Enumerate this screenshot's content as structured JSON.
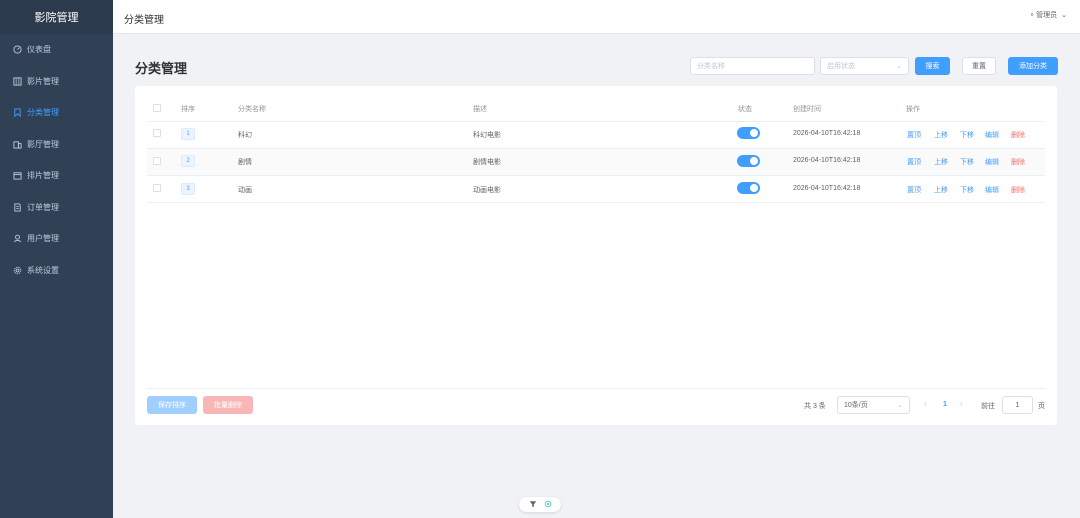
{
  "app": {
    "logo": "影院管理",
    "header_title": "分类管理",
    "user": "管理员"
  },
  "sidebar": {
    "items": [
      {
        "label": "仪表盘",
        "icon": "dashboard-icon"
      },
      {
        "label": "影片管理",
        "icon": "film-icon"
      },
      {
        "label": "分类管理",
        "icon": "bookmark-icon",
        "active": true
      },
      {
        "label": "影厅管理",
        "icon": "building-icon"
      },
      {
        "label": "排片管理",
        "icon": "calendar-icon"
      },
      {
        "label": "订单管理",
        "icon": "document-icon"
      },
      {
        "label": "用户管理",
        "icon": "user-icon"
      },
      {
        "label": "系统设置",
        "icon": "gear-icon"
      }
    ]
  },
  "page": {
    "title": "分类管理"
  },
  "filters": {
    "name_placeholder": "分类名称",
    "status_placeholder": "启用状态",
    "search_label": "搜索",
    "reset_label": "重置",
    "add_label": "添加分类"
  },
  "table": {
    "headers": {
      "order": "排序",
      "name": "分类名称",
      "desc": "描述",
      "status": "状态",
      "created": "创建时间",
      "actions": "操作"
    },
    "rows": [
      {
        "order": "1",
        "name": "科幻",
        "desc": "科幻电影",
        "enabled": true,
        "created": "2026-04-10T16:42:18"
      },
      {
        "order": "2",
        "name": "剧情",
        "desc": "剧情电影",
        "enabled": true,
        "created": "2026-04-10T16:42:18"
      },
      {
        "order": "3",
        "name": "动画",
        "desc": "动画电影",
        "enabled": true,
        "created": "2026-04-10T16:42:18"
      }
    ],
    "actions": {
      "top": "置顶",
      "up": "上移",
      "down": "下移",
      "edit": "编辑",
      "delete": "删除"
    }
  },
  "footer": {
    "save_order": "保存排序",
    "batch_delete": "批量删除",
    "total": "共 3 条",
    "page_size": "10条/页",
    "current_page": "1",
    "goto_label": "前往",
    "goto_value": "1",
    "page_unit": "页"
  },
  "colors": {
    "primary": "#409eff",
    "danger": "#f56c6c",
    "sidebar": "#304156"
  }
}
